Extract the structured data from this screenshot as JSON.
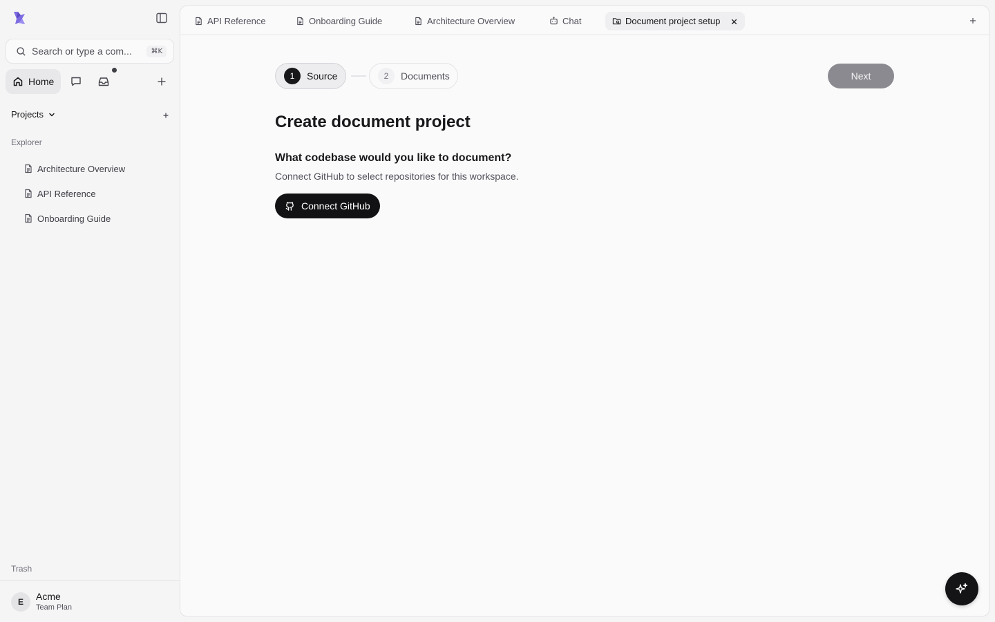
{
  "sidebar": {
    "search": {
      "placeholder": "Search or type a com...",
      "value": "",
      "shortcut": "⌘K"
    },
    "nav": {
      "home_label": "Home"
    },
    "projects_label": "Projects",
    "explorer_label": "Explorer",
    "explorer_items": [
      {
        "label": "Architecture Overview",
        "icon": "file-text-icon"
      },
      {
        "label": "API Reference",
        "icon": "file-text-icon"
      },
      {
        "label": "Onboarding Guide",
        "icon": "file-text-icon"
      }
    ],
    "trash_label": "Trash",
    "footer": {
      "avatar_initial": "E",
      "org_name": "Acme",
      "plan": "Team Plan"
    }
  },
  "tabs": [
    {
      "label": "API Reference",
      "icon": "file-text-icon",
      "active": false
    },
    {
      "label": "Onboarding Guide",
      "icon": "file-text-icon",
      "active": false
    },
    {
      "label": "Architecture Overview",
      "icon": "file-text-icon",
      "active": false
    },
    {
      "label": "Chat",
      "icon": "bot-icon",
      "active": false
    },
    {
      "label": "Document project setup",
      "icon": "folder-search-icon",
      "active": true
    }
  ],
  "wizard": {
    "steps": [
      {
        "number": "1",
        "label": "Source",
        "active": true
      },
      {
        "number": "2",
        "label": "Documents",
        "active": false
      }
    ],
    "next_label": "Next",
    "title": "Create document project",
    "question": "What codebase would you like to document?",
    "helper": "Connect GitHub to select repositories for this workspace.",
    "connect_label": "Connect GitHub"
  },
  "colors": {
    "accent_logo": "#6d5bd0",
    "primary_dark": "#121214",
    "disabled_button": "#8a8a90",
    "sidebar_bg": "#f5f5f6",
    "panel_bg": "#fafafb"
  }
}
